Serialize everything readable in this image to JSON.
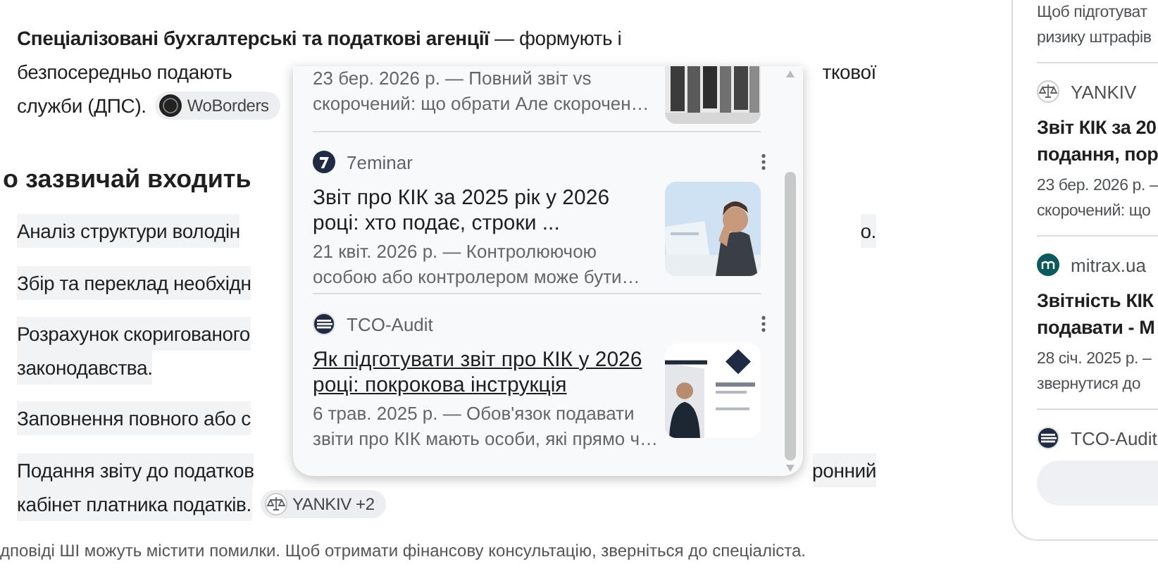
{
  "article": {
    "intro_rows": [
      {
        "left": "**Спеціалізовані бухгалтерські та податкові агенції** — формують і"
      },
      {
        "left": "безпосередньо подають",
        "right": "ткової"
      },
      {
        "left": "служби (ДПС).",
        "chip": "WoBorders"
      }
    ],
    "heading": "о зазвичай входить",
    "steps": [
      {
        "rows": [
          {
            "left": "Аналіз структури володін",
            "right": "о."
          }
        ]
      },
      {
        "rows": [
          {
            "left": "Збір та переклад необхідн"
          }
        ]
      },
      {
        "rows": [
          {
            "left": "Розрахунок скоригованого"
          },
          {
            "left": "законодавства."
          }
        ]
      },
      {
        "rows": [
          {
            "left": "Заповнення повного або с"
          }
        ]
      },
      {
        "rows": [
          {
            "left": "Подання звіту до податков",
            "right": "ронний"
          },
          {
            "left": "кабінет платника податків.",
            "chip": "YANKIV +2"
          }
        ]
      }
    ],
    "disclaimer": "дповіді ШІ можуть містити помилки. Щоб отримати фінансову консультацію, зверніться до спеціаліста."
  },
  "popover": {
    "items": [
      {
        "kind": "partial",
        "snippet": [
          "23 бер. 2026 р. — Повний звіт vs",
          "скорочений: що обрати Але скорочен…"
        ]
      },
      {
        "kind": "full",
        "source": "7eminar",
        "title": [
          "Звіт про КІК за 2025 рік у 2026",
          "році: хто подає, строки ..."
        ],
        "hovered": false,
        "snippet": [
          "21 квіт. 2026 р. — Контролюючою",
          "особою або контролером може бути…"
        ]
      },
      {
        "kind": "full",
        "source": "TCO-Audit",
        "title": [
          "Як підготувати звіт про КІК у 2026",
          "році: покрокова інструкція"
        ],
        "hovered": true,
        "snippet": [
          "6 трав. 2025 р. — Обов'язок подавати",
          "звіти про КІК мають особи, які прямо ч…"
        ]
      }
    ]
  },
  "sidebar": {
    "top_snippet": [
      "Щоб підготуват",
      "ризику штрафів"
    ],
    "items": [
      {
        "source": "YANKIV",
        "title": [
          "Звіт КІК за 20",
          "подання, пор"
        ],
        "snippet": [
          "23 бер. 2026 р. –",
          "скорочений: що"
        ]
      },
      {
        "source": "mitrax.ua",
        "title": [
          "Звітність КІК",
          "подавати - М"
        ],
        "snippet": [
          "28 січ. 2025 р. –",
          "звернутися до"
        ]
      },
      {
        "source": "TCO-Audit"
      }
    ]
  }
}
